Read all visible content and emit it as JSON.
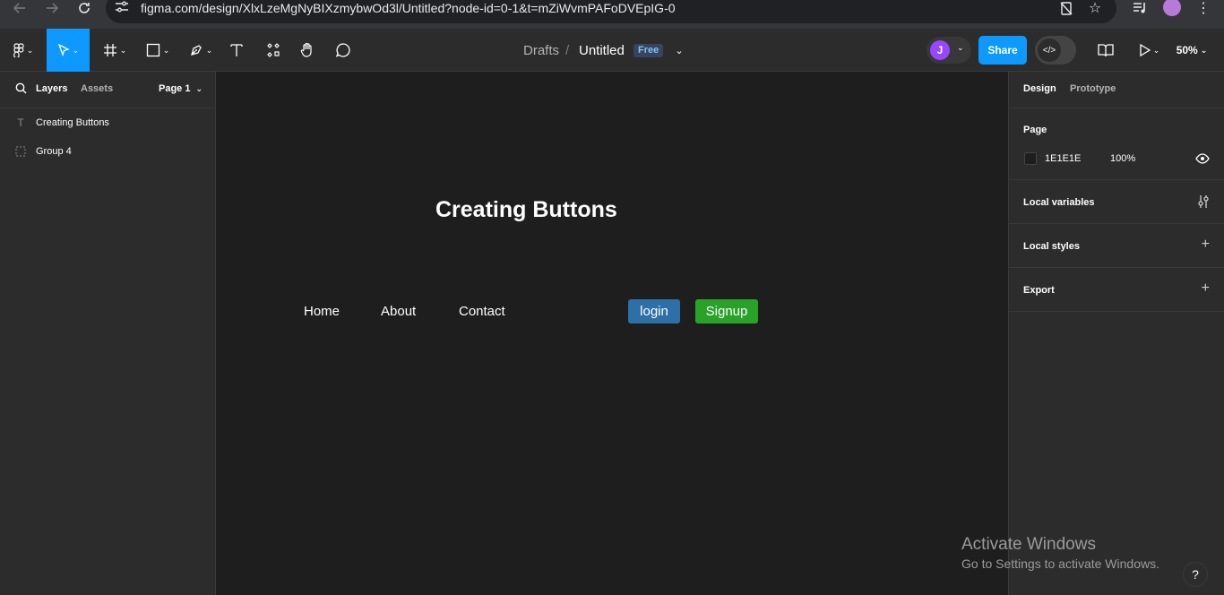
{
  "browser": {
    "url": "figma.com/design/XlxLzeMgNyBIXzmybwOd3l/Untitled?node-id=0-1&t=mZiWvmPAFoDVEpIG-0"
  },
  "toolbar": {
    "breadcrumb_parent": "Drafts",
    "separator": "/",
    "file_name": "Untitled",
    "plan_badge": "Free",
    "avatar_initial": "J",
    "share_label": "Share",
    "zoom": "50%"
  },
  "left_panel": {
    "tabs": {
      "layers": "Layers",
      "assets": "Assets"
    },
    "page_selector": "Page 1",
    "layers": [
      {
        "label": "Creating Buttons",
        "type": "text"
      },
      {
        "label": "Group 4",
        "type": "group"
      }
    ]
  },
  "canvas": {
    "title": "Creating Buttons",
    "nav_links": [
      "Home",
      "About",
      "Contact"
    ],
    "login_label": "login",
    "signup_label": "Signup",
    "colors": {
      "login": "#2f6fa8",
      "signup": "#2aa22a",
      "background": "#1e1e1e"
    }
  },
  "right_panel": {
    "tabs": {
      "design": "Design",
      "prototype": "Prototype"
    },
    "page_section_title": "Page",
    "page_color": "1E1E1E",
    "page_opacity": "100%",
    "sections": [
      "Local variables",
      "Local styles",
      "Export"
    ]
  },
  "watermark": {
    "title": "Activate Windows",
    "subtitle": "Go to Settings to activate Windows."
  },
  "help_label": "?"
}
